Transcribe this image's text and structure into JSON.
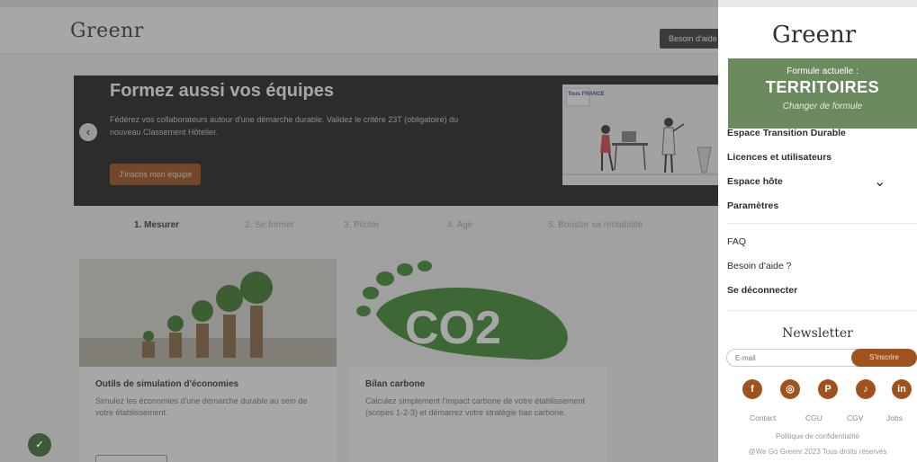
{
  "header": {
    "logo": "Greenr",
    "help_button": "Besoin d'aide"
  },
  "hero": {
    "title": "Formez aussi vos équipes",
    "text": "Fédérez vos collaborateurs autour d'une démarche durable. Validez le critère 23T (obligatoire) du nouveau Classement Hôtelier.",
    "button": "J'inscris mon équipe",
    "image_label": "Tous FRANCE"
  },
  "tabs": [
    "1. Mesurer",
    "2. Se former",
    "3. Piloter",
    "4. Agir",
    "5. Booster sa rentabilité"
  ],
  "cards": [
    {
      "title": "Outils de simulation d'économies",
      "text": "Simulez les économies d'une démarche durable au sein de votre établissement."
    },
    {
      "title": "Bilan carbone",
      "text": "Calculez simplement l'impact carbone de votre établissement (scopes 1-2-3) et démarrez votre stratégie bas carbone.",
      "image_text": "CO2"
    }
  ],
  "panel": {
    "logo": "Greenr",
    "formula_label": "Formule actuelle :",
    "formula_name": "TERRITOIRES",
    "formula_change": "Changer de formule",
    "menu": {
      "transition": "Espace Transition Durable",
      "licences": "Licences et utilisateurs",
      "host": "Espace hôte",
      "settings": "Paramètres",
      "faq": "FAQ",
      "help": "Besoin d'aide ?",
      "logout": "Se déconnecter"
    },
    "newsletter": {
      "title": "Newsletter",
      "placeholder": "E-mail",
      "button": "S'inscrire"
    },
    "footer": {
      "links": [
        "Contact",
        "CGU",
        "CGV",
        "Jobs"
      ],
      "privacy": "Politique de confidentialité",
      "copyright": "@We Go Greenr 2023 Tous droits réservés"
    }
  },
  "colors": {
    "accent": "#a0521c",
    "formula_bg": "#6b8a5e",
    "hero_bg": "#1f1f1f"
  },
  "icons": {
    "social": [
      "facebook-icon",
      "instagram-icon",
      "pinterest-icon",
      "tiktok-icon",
      "linkedin-icon"
    ]
  }
}
